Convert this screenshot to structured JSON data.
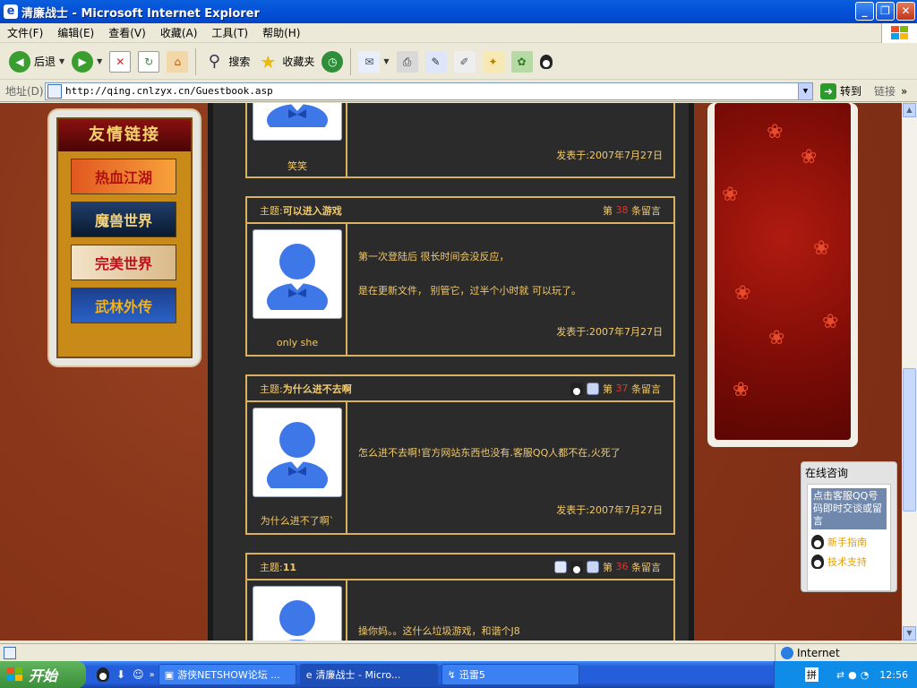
{
  "window": {
    "title": "清廉战士 - Microsoft Internet Explorer"
  },
  "menu": [
    "文件(F)",
    "编辑(E)",
    "查看(V)",
    "收藏(A)",
    "工具(T)",
    "帮助(H)"
  ],
  "toolbar": {
    "back": "后退",
    "search": "搜索",
    "favorites": "收藏夹"
  },
  "address": {
    "label": "地址(D)",
    "url": "http://qing.cnlzyx.cn/Guestbook.asp",
    "go": "转到",
    "links": "链接"
  },
  "left_panel": {
    "title": "友情链接",
    "banners": [
      "热血江湖",
      "魔兽世界",
      "完美世界",
      "武林外传"
    ]
  },
  "posts": [
    {
      "user": "笑笑",
      "date": "发表于:2007年7月27日"
    },
    {
      "subject_prefix": "主题:",
      "subject": "可以进入游戏",
      "no_prefix": "第",
      "no": "38",
      "no_suffix": "条留言",
      "user": "only she",
      "line1": "第一次登陆后 很长时间会没反应，",
      "line2": "是在更新文件，  别管它，过半个小时就 可以玩了。",
      "date": "发表于:2007年7月27日"
    },
    {
      "subject_prefix": "主题:",
      "subject": "为什么进不去啊",
      "no_prefix": "第",
      "no": "37",
      "no_suffix": "条留言",
      "user": "为什么进不了啊`",
      "line1": "怎么进不去啊!官方网站东西也没有.客服QQ人都不在,火死了",
      "date": "发表于:2007年7月27日"
    },
    {
      "subject_prefix": "主题:",
      "subject": "11",
      "no_prefix": "第",
      "no": "36",
      "no_suffix": "条留言",
      "line1": "操你妈。。这什么垃圾游戏，和谐个J8"
    }
  ],
  "consult": {
    "title": "在线咨询",
    "hint": "点击客服QQ号码即时交谈或留言",
    "link1": "新手指南",
    "link2": "技术支持"
  },
  "status": {
    "zone": "Internet"
  },
  "taskbar": {
    "start": "开始",
    "tasks": [
      "游侠NETSHOW论坛 ...",
      "清廉战士 - Micro...",
      "迅雷5"
    ],
    "clock": "12:56"
  }
}
